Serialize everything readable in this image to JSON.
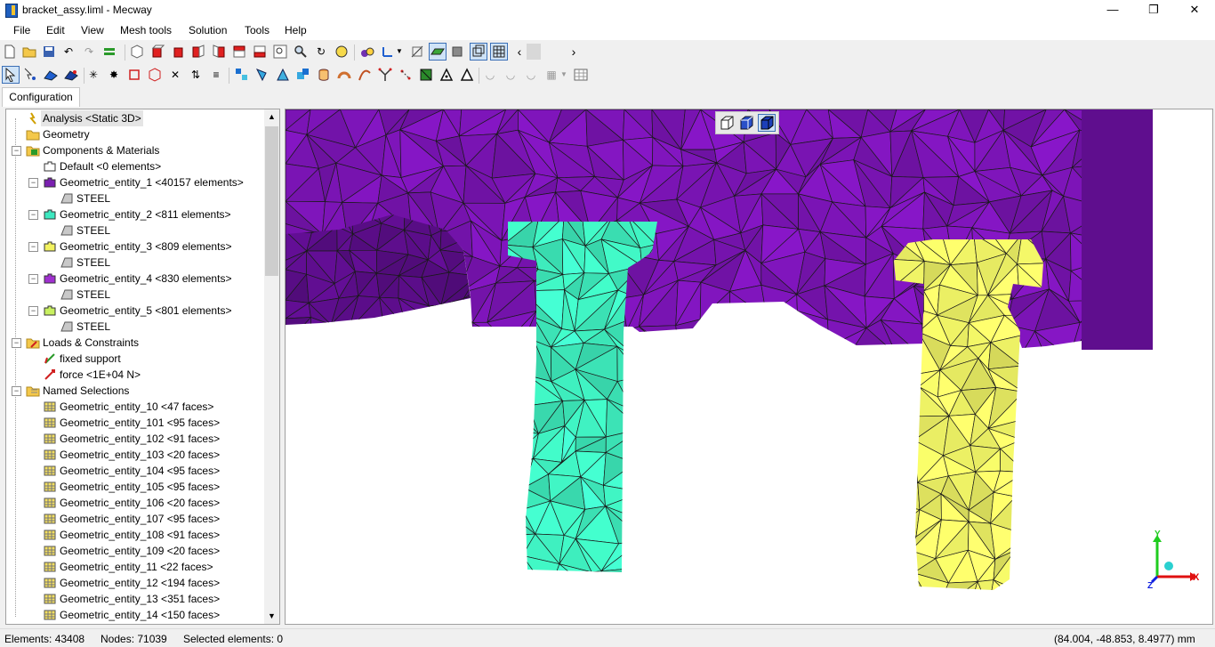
{
  "window": {
    "title": "bracket_assy.liml - Mecway"
  },
  "menu": [
    "File",
    "Edit",
    "View",
    "Mesh tools",
    "Solution",
    "Tools",
    "Help"
  ],
  "tabs": {
    "configuration": "Configuration"
  },
  "tree": {
    "analysis": "Analysis <Static 3D>",
    "geometry": "Geometry",
    "components": "Components & Materials",
    "default": "Default <0 elements>",
    "entities": [
      {
        "label": "Geometric_entity_1 <40157 elements>",
        "material": "STEEL",
        "color": "#7a1fb0"
      },
      {
        "label": "Geometric_entity_2 <811 elements>",
        "material": "STEEL",
        "color": "#3de8c0"
      },
      {
        "label": "Geometric_entity_3 <809 elements>",
        "material": "STEEL",
        "color": "#f2f260"
      },
      {
        "label": "Geometric_entity_4 <830 elements>",
        "material": "STEEL",
        "color": "#a030d0"
      },
      {
        "label": "Geometric_entity_5 <801 elements>",
        "material": "STEEL",
        "color": "#c8f060"
      }
    ],
    "loads": "Loads & Constraints",
    "constraints": [
      "fixed support",
      "force <1E+04 N>"
    ],
    "named_selections": "Named Selections",
    "selections": [
      "Geometric_entity_10 <47 faces>",
      "Geometric_entity_101 <95 faces>",
      "Geometric_entity_102 <91 faces>",
      "Geometric_entity_103 <20 faces>",
      "Geometric_entity_104 <95 faces>",
      "Geometric_entity_105 <95 faces>",
      "Geometric_entity_106 <20 faces>",
      "Geometric_entity_107 <95 faces>",
      "Geometric_entity_108 <91 faces>",
      "Geometric_entity_109 <20 faces>",
      "Geometric_entity_11 <22 faces>",
      "Geometric_entity_12 <194 faces>",
      "Geometric_entity_13 <351 faces>",
      "Geometric_entity_14 <150 faces>"
    ]
  },
  "viewport": {
    "colors": {
      "bracket": "#7a14b4",
      "bolt_left": "#3ff0c0",
      "bolt_right": "#f0f466"
    },
    "axes": {
      "x": "X",
      "y": "Y",
      "z": "Z"
    }
  },
  "status": {
    "elements": "Elements: 43408",
    "nodes": "Nodes: 71039",
    "selected": "Selected elements: 0",
    "coords": "(84.004, -48.853, 8.4977) mm"
  }
}
